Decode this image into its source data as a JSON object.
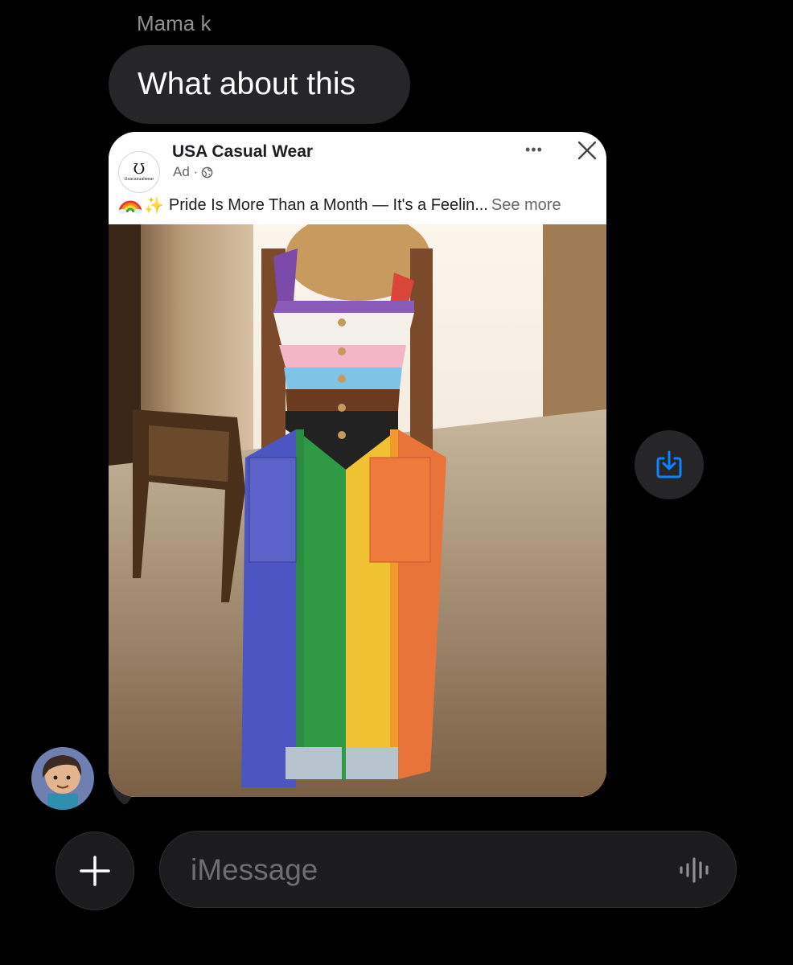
{
  "conversation": {
    "sender_name": "Mama k",
    "message_text": "What about this"
  },
  "ad": {
    "brand_name": "USA Casual Wear",
    "logo_glyph": "Ʊ",
    "logo_wordmark": "Usacasualwear",
    "meta": "Ad ·",
    "caption": "Pride Is More Than a Month — It's a Feelin...",
    "see_more": "See more",
    "more_glyph": "•••"
  },
  "composer": {
    "placeholder": "iMessage"
  },
  "icons": {
    "save": "save-to-photos-icon",
    "plus": "plus-icon",
    "mic": "audio-waveform-icon",
    "close": "close-icon",
    "more": "more-dots-icon",
    "globe": "globe-icon"
  },
  "colors": {
    "background": "#000000",
    "bubble": "#262628",
    "accent": "#0a84ff"
  }
}
